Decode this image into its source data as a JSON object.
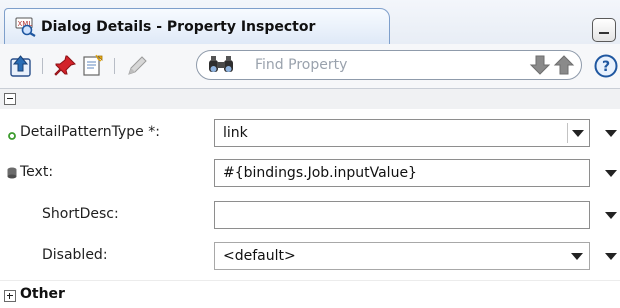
{
  "window": {
    "tab_title": "Dialog Details - Property Inspector",
    "tab_icon": "xml-inspect-icon",
    "minimize_icon": "minimize-icon"
  },
  "toolbar": {
    "buttons": [
      {
        "icon": "up-arrow-page-icon"
      },
      {
        "icon": "pin-icon"
      },
      {
        "icon": "edit-source-icon"
      },
      {
        "icon": "pencil-icon"
      }
    ],
    "search": {
      "placeholder": "Find Property",
      "value": "",
      "icon": "binoculars-icon",
      "prev_icon": "arrow-down-icon",
      "next_icon": "arrow-up-icon"
    },
    "help_icon": "help-icon"
  },
  "properties": [
    {
      "label": "DetailPatternType *:",
      "value": "link",
      "indicator": "required-dot-icon",
      "control": "combo"
    },
    {
      "label": "Text:",
      "value": "#{bindings.Job.inputValue}",
      "indicator": "database-icon",
      "control": "text"
    },
    {
      "label": "ShortDesc:",
      "value": "",
      "indicator": "",
      "control": "text"
    },
    {
      "label": "Disabled:",
      "value": "<default>",
      "indicator": "",
      "control": "select"
    }
  ],
  "sections": {
    "other_label": "Other"
  },
  "colors": {
    "accent_blue": "#2a6db5",
    "required_green": "#3c9b2e"
  }
}
